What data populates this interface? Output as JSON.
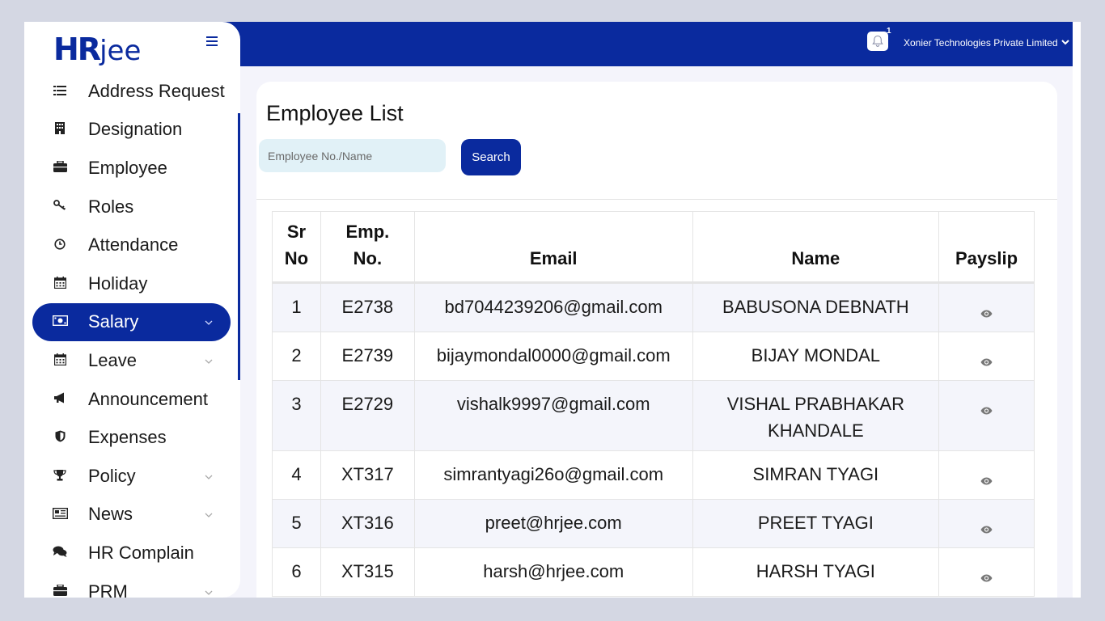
{
  "app": {
    "logo": {
      "primary": "HR",
      "secondary": "jee"
    },
    "brand_color": "#0a2a9e"
  },
  "header": {
    "notification_count": "1",
    "company_name": "Xonier Technologies Private Limited"
  },
  "sidebar": {
    "items": [
      {
        "label": "Address Request",
        "icon": "list-icon",
        "has_submenu": false,
        "active": false
      },
      {
        "label": "Designation",
        "icon": "building-icon",
        "has_submenu": false,
        "active": false
      },
      {
        "label": "Employee",
        "icon": "briefcase-icon",
        "has_submenu": false,
        "active": false
      },
      {
        "label": "Roles",
        "icon": "key-icon",
        "has_submenu": false,
        "active": false
      },
      {
        "label": "Attendance",
        "icon": "clock-icon",
        "has_submenu": false,
        "active": false
      },
      {
        "label": "Holiday",
        "icon": "calendar-icon",
        "has_submenu": false,
        "active": false
      },
      {
        "label": "Salary",
        "icon": "money-icon",
        "has_submenu": true,
        "active": true
      },
      {
        "label": "Leave",
        "icon": "calendar-icon",
        "has_submenu": true,
        "active": false
      },
      {
        "label": "Announcement",
        "icon": "megaphone-icon",
        "has_submenu": false,
        "active": false
      },
      {
        "label": "Expenses",
        "icon": "shield-icon",
        "has_submenu": false,
        "active": false
      },
      {
        "label": "Policy",
        "icon": "trophy-icon",
        "has_submenu": true,
        "active": false
      },
      {
        "label": "News",
        "icon": "newspaper-icon",
        "has_submenu": true,
        "active": false
      },
      {
        "label": "HR Complain",
        "icon": "comments-icon",
        "has_submenu": false,
        "active": false
      },
      {
        "label": "PRM",
        "icon": "briefcase-icon",
        "has_submenu": true,
        "active": false
      }
    ]
  },
  "main": {
    "title": "Employee List",
    "search": {
      "placeholder": "Employee No./Name",
      "value": "",
      "button_label": "Search"
    },
    "table": {
      "headers": {
        "sr": [
          "Sr",
          "No"
        ],
        "emp": [
          "Emp.",
          "No."
        ],
        "email": "Email",
        "name": "Name",
        "payslip": "Payslip"
      },
      "rows": [
        {
          "sr": "1",
          "emp_no": "E2738",
          "email": "bd7044239206@gmail.com",
          "name": [
            "BABUSONA DEBNATH"
          ]
        },
        {
          "sr": "2",
          "emp_no": "E2739",
          "email": "bijaymondal0000@gmail.com",
          "name": [
            "BIJAY MONDAL"
          ]
        },
        {
          "sr": "3",
          "emp_no": "E2729",
          "email": "vishalk9997@gmail.com",
          "name": [
            "VISHAL PRABHAKAR",
            "KHANDALE"
          ]
        },
        {
          "sr": "4",
          "emp_no": "XT317",
          "email": "simrantyagi26o@gmail.com",
          "name": [
            "SIMRAN TYAGI"
          ]
        },
        {
          "sr": "5",
          "emp_no": "XT316",
          "email": "preet@hrjee.com",
          "name": [
            "PREET TYAGI"
          ]
        },
        {
          "sr": "6",
          "emp_no": "XT315",
          "email": "harsh@hrjee.com",
          "name": [
            "HARSH TYAGI"
          ]
        }
      ]
    }
  }
}
